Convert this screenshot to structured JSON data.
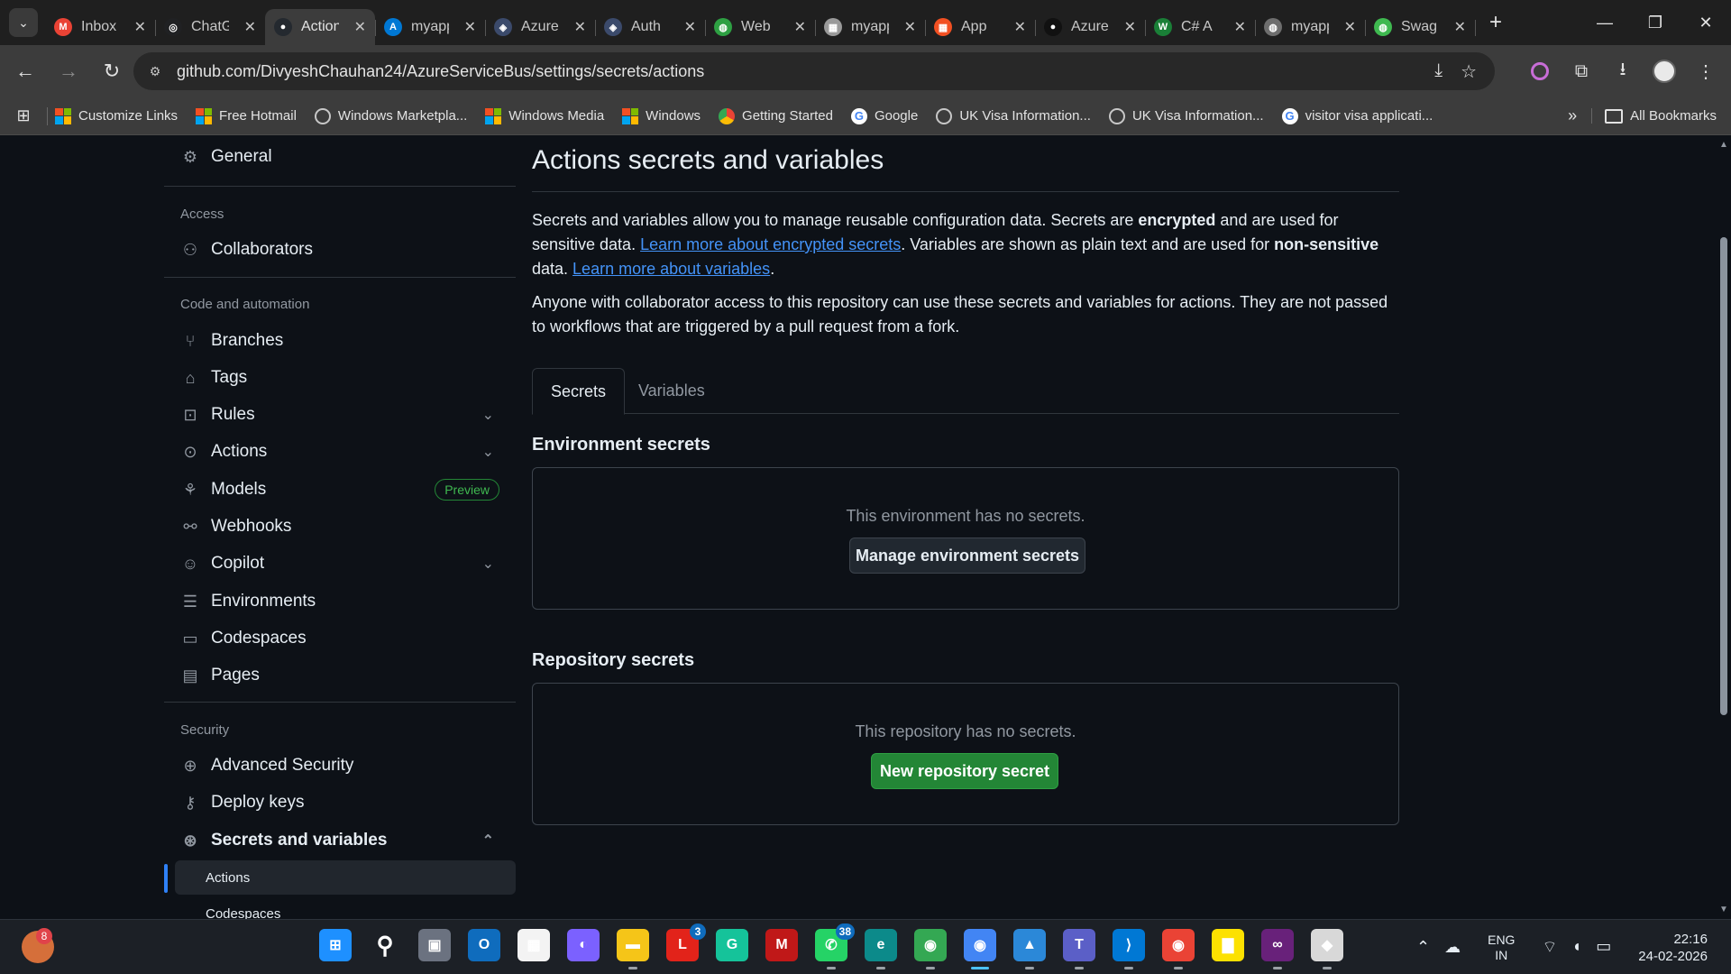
{
  "browser": {
    "tabs": [
      {
        "title": "Inbox",
        "fav_color": "#ea4335",
        "fav_glyph": "M",
        "active": false
      },
      {
        "title": "ChatGPT",
        "fav_color": "#202123",
        "fav_glyph": "◎",
        "active": false
      },
      {
        "title": "Actions",
        "fav_color": "#24292f",
        "fav_glyph": "●",
        "active": true
      },
      {
        "title": "myapp",
        "fav_color": "#0078d4",
        "fav_glyph": "A",
        "active": false
      },
      {
        "title": "Azure",
        "fav_color": "#3b4a6b",
        "fav_glyph": "◈",
        "active": false
      },
      {
        "title": "Auth",
        "fav_color": "#3b4a6b",
        "fav_glyph": "◈",
        "active": false
      },
      {
        "title": "Web",
        "fav_color": "#2ea043",
        "fav_glyph": "◍",
        "active": false
      },
      {
        "title": "myapp",
        "fav_color": "#9a9a9a",
        "fav_glyph": "▦",
        "active": false
      },
      {
        "title": "App",
        "fav_color": "#f25022",
        "fav_glyph": "▦",
        "active": false
      },
      {
        "title": "Azure",
        "fav_color": "#111111",
        "fav_glyph": "●",
        "active": false
      },
      {
        "title": "C# A",
        "fav_color": "#1a7f37",
        "fav_glyph": "W",
        "active": false
      },
      {
        "title": "myapp",
        "fav_color": "#6e6e6e",
        "fav_glyph": "◍",
        "active": false
      },
      {
        "title": "Swag",
        "fav_color": "#3fb950",
        "fav_glyph": "◍",
        "active": false
      }
    ],
    "url": "github.com/DivyeshChauhan24/AzureServiceBus/settings/secrets/actions",
    "bookmarks": [
      {
        "label": "Customize Links",
        "icon": "ms-logo"
      },
      {
        "label": "Free Hotmail",
        "icon": "ms-logo"
      },
      {
        "label": "Windows Marketpla...",
        "icon": "globe-icon"
      },
      {
        "label": "Windows Media",
        "icon": "ms-logo"
      },
      {
        "label": "Windows",
        "icon": "ms-logo"
      },
      {
        "label": "Getting Started",
        "icon": "chrome-icon"
      },
      {
        "label": "Google",
        "icon": "google-icon"
      },
      {
        "label": "UK Visa Information...",
        "icon": "globe-icon"
      },
      {
        "label": "UK Visa Information...",
        "icon": "globe-icon"
      },
      {
        "label": "visitor visa applicati...",
        "icon": "google-icon"
      }
    ],
    "all_bookmarks": "All Bookmarks"
  },
  "sidebar": {
    "general": "General",
    "heading_access": "Access",
    "collaborators": "Collaborators",
    "heading_code": "Code and automation",
    "branches": "Branches",
    "tags": "Tags",
    "rules": "Rules",
    "actions": "Actions",
    "models": "Models",
    "models_badge": "Preview",
    "webhooks": "Webhooks",
    "copilot": "Copilot",
    "environments": "Environments",
    "codespaces": "Codespaces",
    "pages": "Pages",
    "heading_security": "Security",
    "advanced_security": "Advanced Security",
    "deploy_keys": "Deploy keys",
    "secrets_and_variables": "Secrets and variables",
    "sub_actions": "Actions",
    "sub_codespaces": "Codespaces"
  },
  "main": {
    "title": "Actions secrets and variables",
    "intro": {
      "p1_a": "Secrets and variables allow you to manage reusable configuration data. Secrets are ",
      "p1_b": "encrypted",
      "p1_c": " and are used for sensitive data. ",
      "p1_link1": "Learn more about encrypted secrets",
      "p1_d": ". Variables are shown as plain text and are used for ",
      "p1_e": "non-sensitive",
      "p1_f": " data. ",
      "p1_link2": "Learn more about variables",
      "p1_g": ".",
      "p2": "Anyone with collaborator access to this repository can use these secrets and variables for actions. They are not passed to workflows that are triggered by a pull request from a fork."
    },
    "tabs": {
      "secrets": "Secrets",
      "variables": "Variables"
    },
    "env_title": "Environment secrets",
    "env_empty": "This environment has no secrets.",
    "env_button": "Manage environment secrets",
    "repo_title": "Repository secrets",
    "repo_empty": "This repository has no secrets.",
    "repo_button": "New repository secret"
  },
  "taskbar": {
    "weather_badge": "8",
    "apps": [
      {
        "name": "windows-start-icon",
        "color": "#1e90ff",
        "glyph": "⊞",
        "badge": "",
        "running": false
      },
      {
        "name": "search-icon",
        "color": "transparent",
        "glyph": "⚲",
        "badge": "",
        "running": false
      },
      {
        "name": "task-view-icon",
        "color": "#6b7280",
        "glyph": "▣",
        "badge": "",
        "running": false
      },
      {
        "name": "outlook-icon",
        "color": "#0f6cbd",
        "glyph": "O",
        "badge": "",
        "running": false
      },
      {
        "name": "store-icon",
        "color": "#f3f3f3",
        "glyph": "▦",
        "badge": "",
        "running": false
      },
      {
        "name": "copilot-icon",
        "color": "#7b61ff",
        "glyph": "◐",
        "badge": "",
        "running": false
      },
      {
        "name": "file-explorer-icon",
        "color": "#f5c518",
        "glyph": "▬",
        "badge": "",
        "running": true
      },
      {
        "name": "lenovo-icon",
        "color": "#e2231a",
        "glyph": "L",
        "badge": "3",
        "running": false
      },
      {
        "name": "grammarly-icon",
        "color": "#15c39a",
        "glyph": "G",
        "badge": "",
        "running": false
      },
      {
        "name": "mcafee-icon",
        "color": "#c01818",
        "glyph": "M",
        "badge": "",
        "running": false
      },
      {
        "name": "whatsapp-icon",
        "color": "#25d366",
        "glyph": "✆",
        "badge": "38",
        "running": true
      },
      {
        "name": "edge-icon",
        "color": "#0c8a8a",
        "glyph": "e",
        "badge": "",
        "running": true
      },
      {
        "name": "chrome-icon",
        "color": "#34a853",
        "glyph": "◉",
        "badge": "",
        "running": true
      },
      {
        "name": "chrome-profile-icon",
        "color": "#4285f4",
        "glyph": "◉",
        "badge": "",
        "running": true
      },
      {
        "name": "photos-icon",
        "color": "#2b88d8",
        "glyph": "▲",
        "badge": "",
        "running": true
      },
      {
        "name": "teams-icon",
        "color": "#5b5fc7",
        "glyph": "T",
        "badge": "",
        "running": true
      },
      {
        "name": "vscode-icon",
        "color": "#0078d4",
        "glyph": "⟩",
        "badge": "",
        "running": true
      },
      {
        "name": "chrome-work-icon",
        "color": "#ea4335",
        "glyph": "◉",
        "badge": "",
        "running": true
      },
      {
        "name": "sticky-notes-icon",
        "color": "#fce100",
        "glyph": "▇",
        "badge": "",
        "running": false
      },
      {
        "name": "visual-studio-icon",
        "color": "#68217a",
        "glyph": "∞",
        "badge": "",
        "running": true
      },
      {
        "name": "terminal-app-icon",
        "color": "#d8d8d8",
        "glyph": "◆",
        "badge": "",
        "running": true
      }
    ],
    "lang_line1": "ENG",
    "lang_line2": "IN",
    "time": "22:16",
    "date": "24-02-2026"
  }
}
